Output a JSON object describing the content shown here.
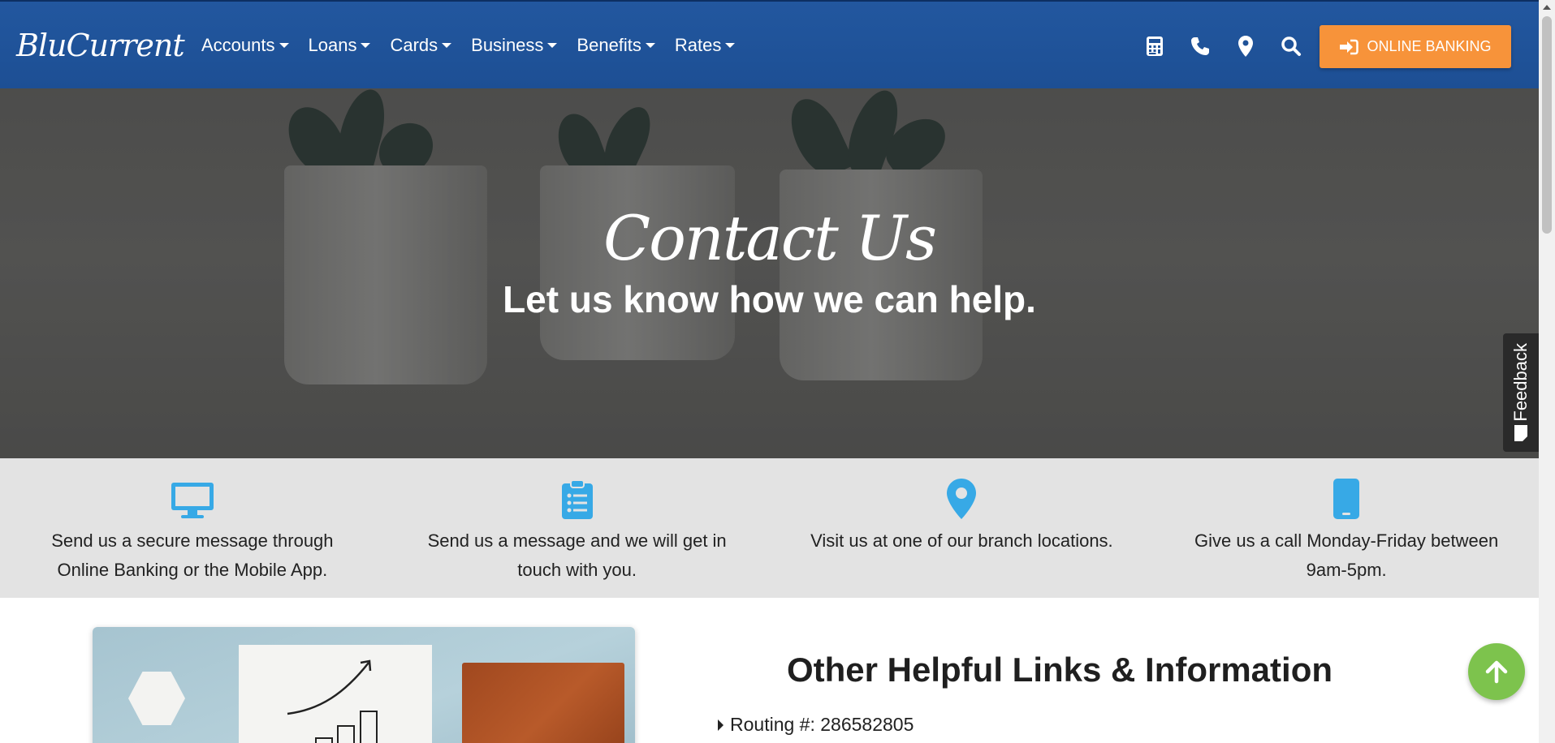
{
  "nav": {
    "logo": "BluCurrent",
    "menu": [
      "Accounts",
      "Loans",
      "Cards",
      "Business",
      "Benefits",
      "Rates"
    ],
    "icons": [
      "calculator-icon",
      "phone-icon",
      "map-marker-icon",
      "search-icon"
    ],
    "online_banking_label": "ONLINE BANKING"
  },
  "hero": {
    "title": "Contact Us",
    "subtitle": "Let us know how we can help."
  },
  "feedback_label": "Feedback",
  "contact_options": [
    {
      "icon": "desktop-icon",
      "text": "Send us a secure message through Online Banking or the Mobile App."
    },
    {
      "icon": "clipboard-list-icon",
      "text": "Send us a message and we will get in touch with you."
    },
    {
      "icon": "map-marker-icon",
      "text": "Visit us at one of our branch locations."
    },
    {
      "icon": "mobile-phone-icon",
      "text": "Give us a call Monday-Friday between 9am-5pm."
    }
  ],
  "info": {
    "title": "Other Helpful Links & Information",
    "routing_label": "Routing #: 286582805"
  },
  "colors": {
    "nav_blue": "#1d4f94",
    "accent_orange": "#f7933a",
    "icon_blue": "#37a9e6",
    "to_top_green": "#7dc34d"
  }
}
